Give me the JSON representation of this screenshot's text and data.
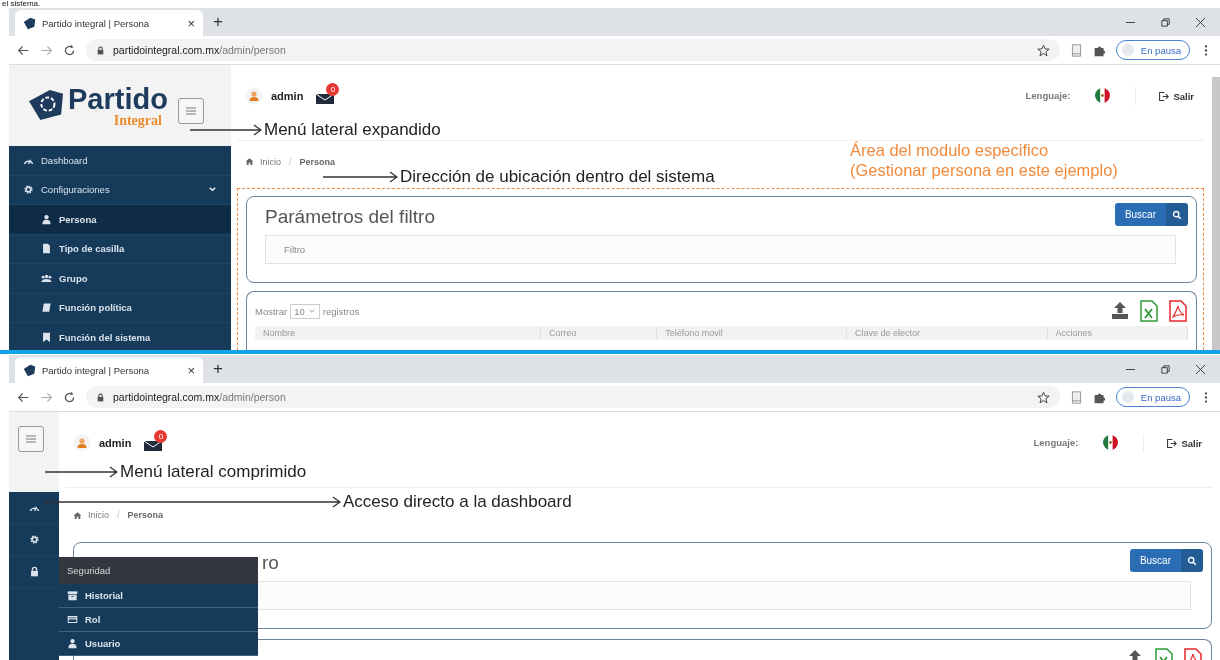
{
  "caption": "el sistema.",
  "windows": [
    {
      "kind": "expanded",
      "tab": {
        "title": "Partido integral | Persona",
        "close": "×"
      },
      "new_tab": "+",
      "address": {
        "host": "partidointegral.com.mx",
        "path": "/admin/person"
      },
      "profile": {
        "label": "En pausa"
      },
      "logo": {
        "name": "Partido",
        "tagline": "Integral"
      },
      "menu": [
        {
          "label": "Dashboard",
          "selected": false
        },
        {
          "label": "Configuraciones",
          "selected": false,
          "expanded": true,
          "children": [
            {
              "label": "Persona",
              "selected": true
            },
            {
              "label": "Tipo de casilla",
              "selected": false
            },
            {
              "label": "Grupo",
              "selected": false
            },
            {
              "label": "Función política",
              "selected": false
            },
            {
              "label": "Función del sistema",
              "selected": false
            }
          ]
        }
      ],
      "user": {
        "name": "admin",
        "badge": "0"
      },
      "language": {
        "label": "Lenguaje:"
      },
      "logout": "Salir",
      "breadcrumb": {
        "separator": "/",
        "items": [
          "Inicio",
          "Persona"
        ]
      },
      "filter": {
        "title": "Parámetros del filtro",
        "button": "Buscar",
        "placeholder": "Filtro"
      },
      "table": {
        "show_label": "Mostrar",
        "page_size": "10",
        "records_label": "registros",
        "columns": [
          "Nombre",
          "Correo",
          "Teléfono movil",
          "Clave de elector",
          "Acciones"
        ]
      },
      "annotations": [
        {
          "text": "Menú lateral expandido"
        },
        {
          "text": "Dirección de ubicación dentro del sistema"
        }
      ],
      "module_area": {
        "lines": [
          "Área del modulo especifico",
          "(Gestionar persona en este ejemplo)"
        ]
      }
    },
    {
      "kind": "compact",
      "tab": {
        "title": "Partido integral | Persona",
        "close": "×"
      },
      "new_tab": "+",
      "address": {
        "host": "partidointegral.com.mx",
        "path": "/admin/person"
      },
      "profile": {
        "label": "En pausa"
      },
      "flyout": {
        "title": "Seguridad",
        "items": [
          {
            "label": "Historial"
          },
          {
            "label": "Rol"
          },
          {
            "label": "Usuario"
          }
        ]
      },
      "user": {
        "name": "admin",
        "badge": "0"
      },
      "language": {
        "label": "Lenguaje:"
      },
      "logout": "Salir",
      "breadcrumb": {
        "separator": "/",
        "items": [
          "Inicio",
          "Persona"
        ]
      },
      "filter": {
        "title": "ro",
        "button": "Buscar"
      },
      "annotations": [
        {
          "text": "Menú lateral comprimido"
        },
        {
          "text": "Acceso directo a la dashboard"
        }
      ]
    }
  ]
}
